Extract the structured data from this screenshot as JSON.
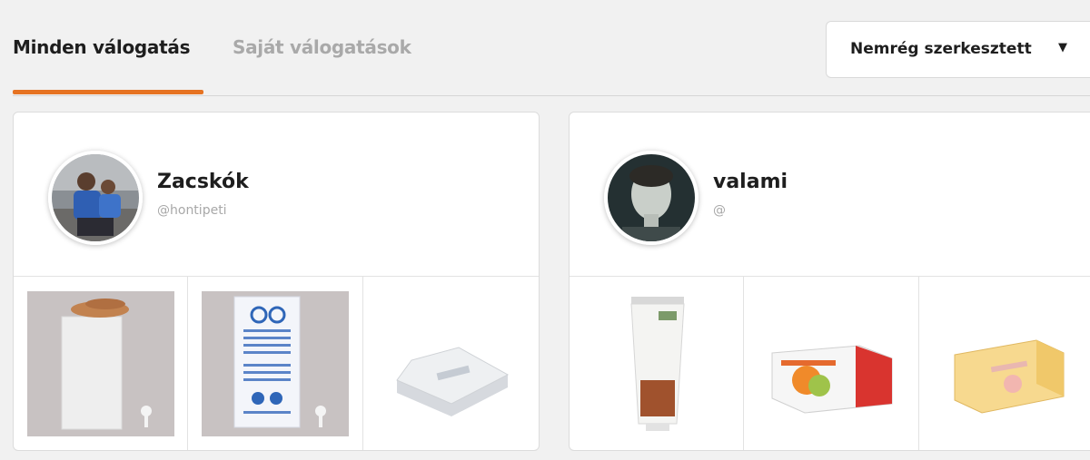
{
  "tabs": {
    "all_label": "Minden válogatás",
    "own_label": "Saját válogatások",
    "accent": "#e67322"
  },
  "sort": {
    "label": "Nemrég szerkesztett",
    "icon": "caret-down-icon"
  },
  "collections": [
    {
      "title": "Zacskók",
      "username": "@hontipeti",
      "products": [
        {
          "name": "paper-bag-with-seeds"
        },
        {
          "name": "printed-paper-bag"
        },
        {
          "name": "white-bag-stack"
        }
      ]
    },
    {
      "title": "valami",
      "username": "@",
      "products": [
        {
          "name": "cream-tube"
        },
        {
          "name": "soap-box"
        },
        {
          "name": "wrapped-soap-bar"
        }
      ]
    }
  ]
}
